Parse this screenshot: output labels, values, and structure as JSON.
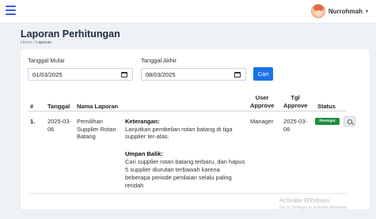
{
  "topbar": {
    "user_name": "Nurrohmah",
    "caret": "▾"
  },
  "page": {
    "title": "Laporan Perhitungan",
    "breadcrumb": {
      "home": "Home",
      "separator": "/",
      "current": "Laporan"
    }
  },
  "filter": {
    "start_label": "Tanggal Mulai",
    "start_value": "01/03/2025",
    "end_label": "Tanggal Akhir",
    "end_value": "08/03/2025",
    "button_label": "Cari"
  },
  "table": {
    "headers": {
      "no": "#",
      "tanggal": "Tanggal",
      "nama": "Nama Laporan",
      "user_approve_1": "User",
      "user_approve_2": "Approve",
      "tgl_approve_1": "Tgl",
      "tgl_approve_2": "Approve",
      "status": "Status"
    },
    "rows": [
      {
        "no": "1.",
        "tanggal_1": "2025-03-",
        "tanggal_2": "06",
        "nama_1": "Pemilihan",
        "nama_2": "Supplier Rotan",
        "nama_3": "Batang",
        "keterangan_title": "Keterangan:",
        "keterangan_1": "Lanjutkan pembelian rotan batang di tiga",
        "keterangan_2": "supplier ter-atas.",
        "umpan_title": "Umpan Balik:",
        "umpan_1": "Cari supplier rotan batang terbaru, dan hapus",
        "umpan_2": "5 supplier diurutan terbawah karena",
        "umpan_3": "beberapa periode penilaian selalu paling",
        "umpan_4": "rendah",
        "user_approve": "Manager",
        "tgl_approve_1": "2025-03-",
        "tgl_approve_2": "06",
        "status": "Disetujui"
      }
    ]
  },
  "watermark": {
    "line1": "Activate Windows",
    "line2": "Go to Settings to activate Windows."
  },
  "colors": {
    "primary": "#1a73e8",
    "success": "#1e8e3e",
    "title": "#1f2d3d"
  },
  "icons": {
    "menu": "hamburger-icon",
    "calendar": "calendar-icon",
    "view": "magnifier-icon"
  }
}
